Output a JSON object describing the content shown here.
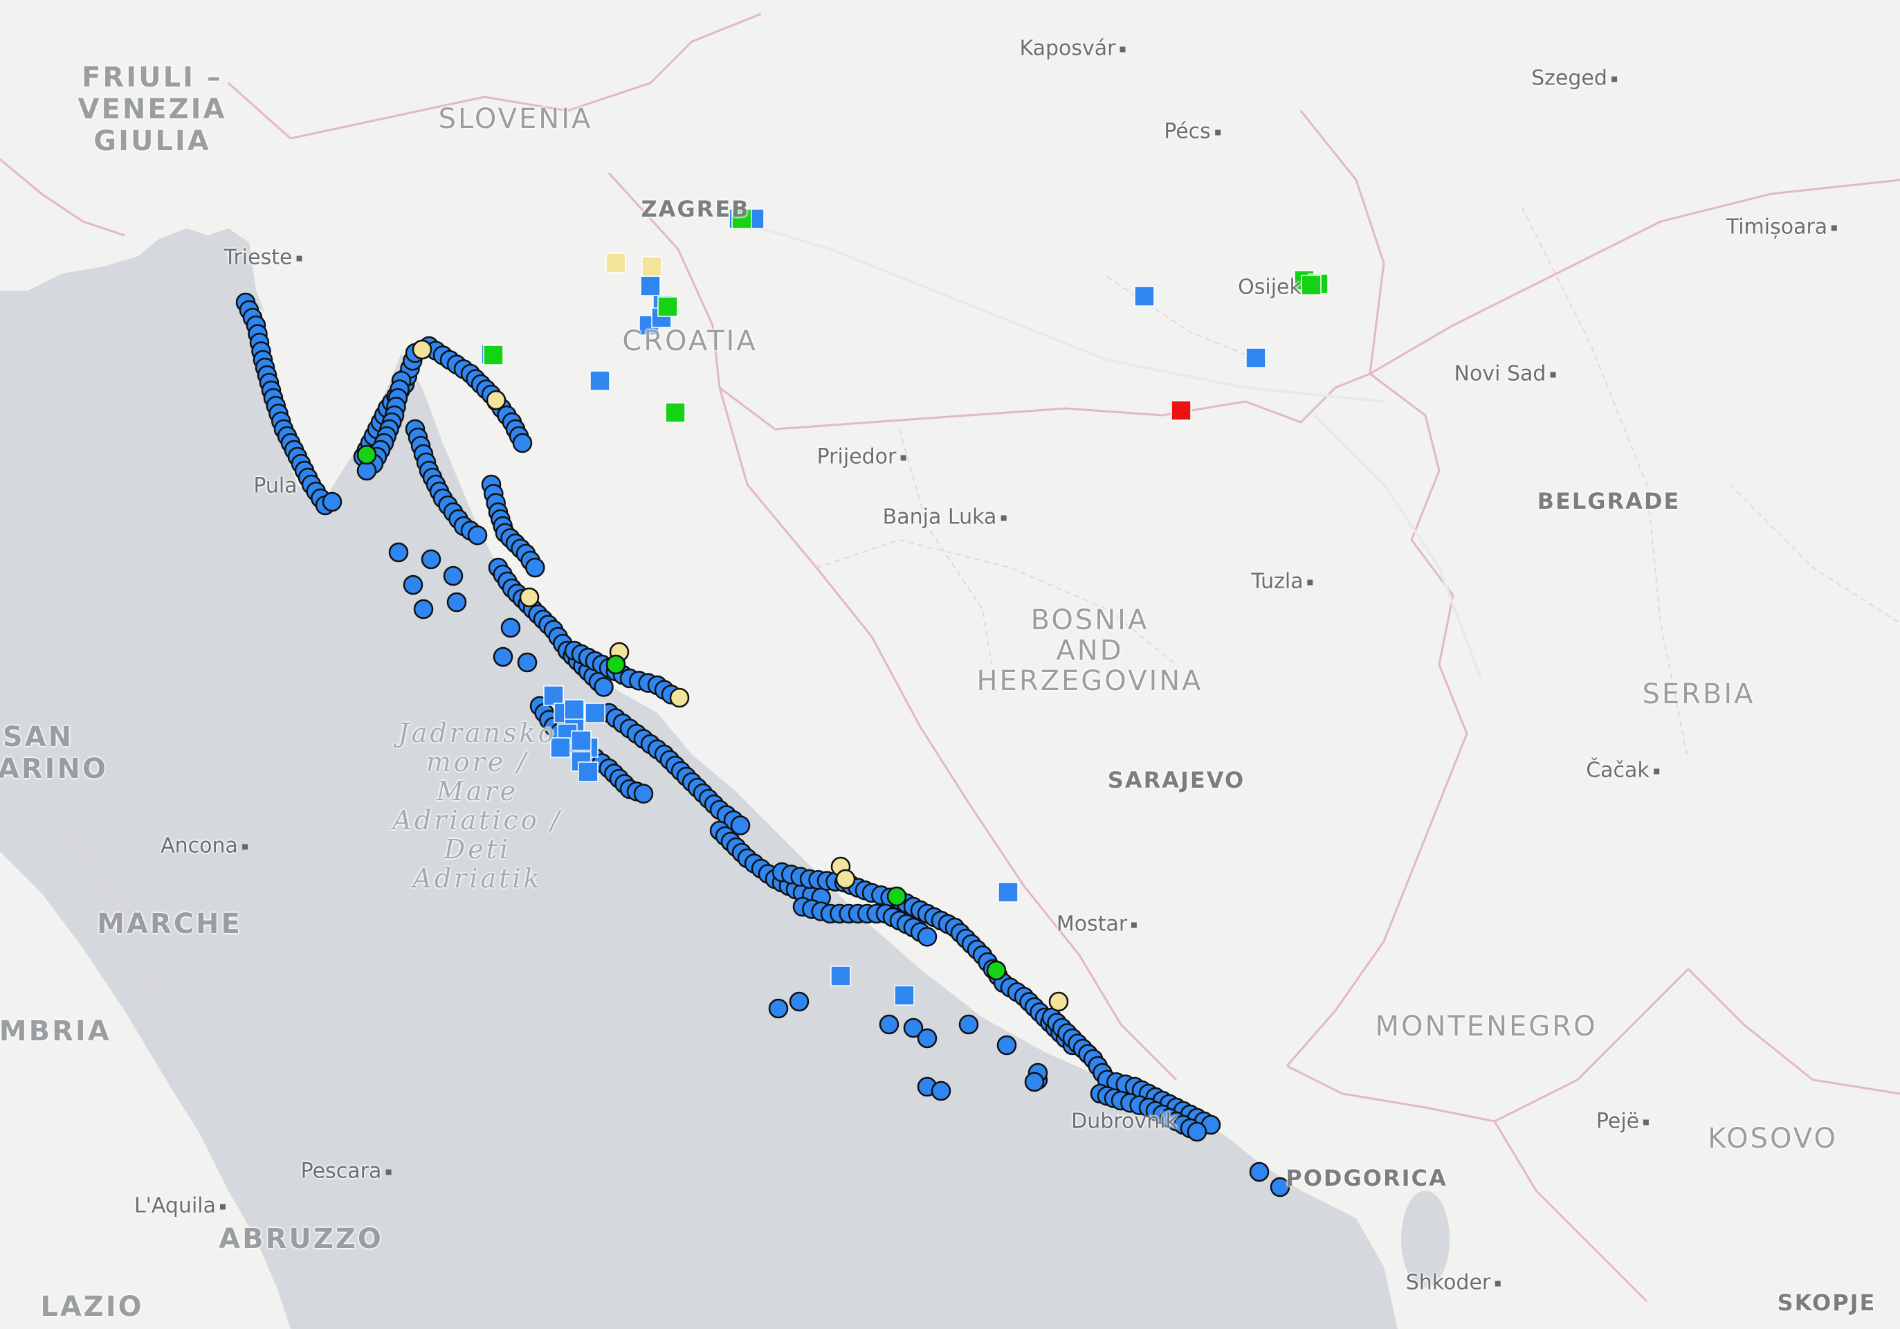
{
  "map": {
    "colors": {
      "land": "#f2f2f0",
      "sea": "#d5d8dc",
      "border": "#e3b8c6",
      "marker_blue": "#2f86f0",
      "marker_yellow": "#f3e49b",
      "marker_green": "#14d214",
      "marker_red": "#ee1111",
      "marker_outline": "#111111"
    },
    "labels": {
      "friuli": "FRIULI –\nVENEZIA\nGIULIA",
      "slovenia": "SLOVENIA",
      "croatia": "CROATIA",
      "bosnia": "BOSNIA\nAND\nHERZEGOVINA",
      "serbia": "SERBIA",
      "montenegro": "MONTENEGRO",
      "kosovo": "KOSOVO",
      "san_marino": "SAN\nMARINO",
      "marche": "MARCHE",
      "umbria": "UMBRIA",
      "abruzzo": "ABRUZZO",
      "lazio": "LAZIO",
      "sea": "Jadransko\nmore /\nMare\nAdriatico /\nDeti\nAdriatik",
      "zagreb": "ZAGREB",
      "belgrade": "BELGRADE",
      "sarajevo": "SARAJEVO",
      "podgorica": "PODGORICA",
      "skopje": "SKOPJE",
      "kaposvar": "Kaposvár",
      "szeged": "Szeged",
      "pecs": "Pécs",
      "timisoara": "Timișoara",
      "trieste": "Trieste",
      "osijek": "Osijek",
      "novi_sad": "Novi Sad",
      "prijedor": "Prijedor",
      "banja_luka": "Banja Luka",
      "tuzla": "Tuzla",
      "cacak": "Čačak",
      "mostar": "Mostar",
      "ancona": "Ancona",
      "pescara": "Pescara",
      "laquila": "L'Aquila",
      "dubrovnik": "Dubrovnik",
      "peje": "Pejë",
      "shkoder": "Shkoder",
      "pula": "Pula"
    }
  }
}
